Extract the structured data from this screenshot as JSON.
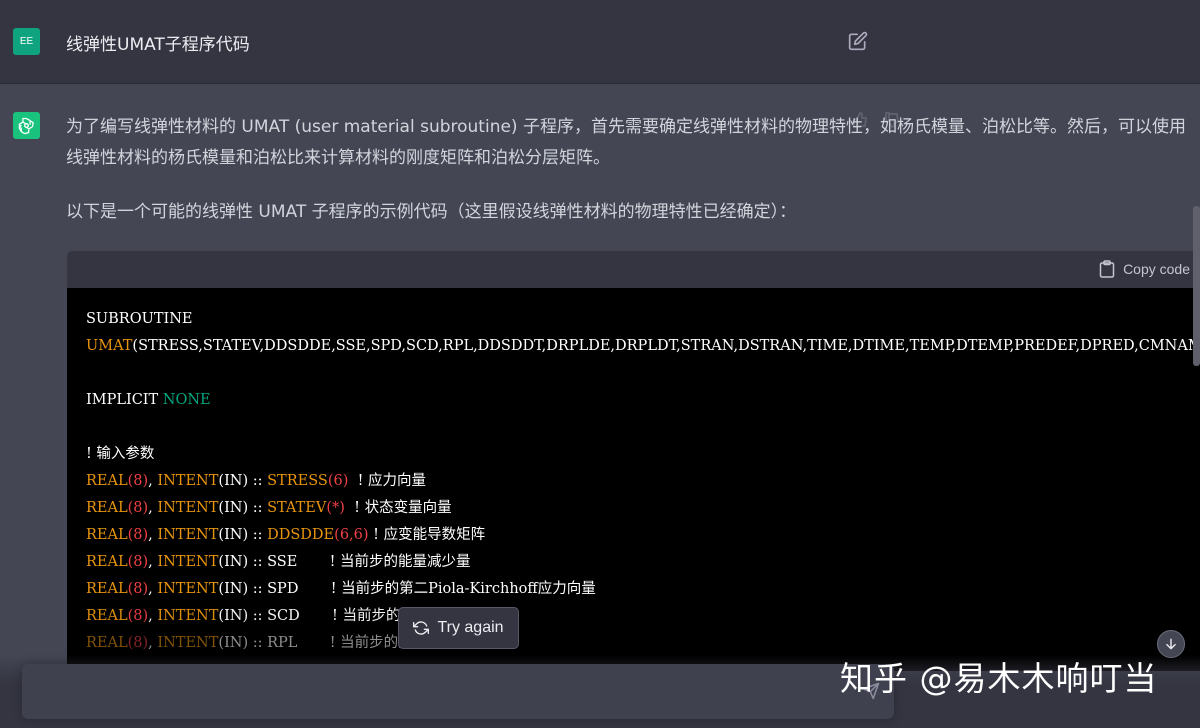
{
  "user": {
    "avatar_initials": "EE",
    "message": "线弹性UMAT子程序代码"
  },
  "assistant": {
    "para1": "为了编写线弹性材料的 UMAT (user material subroutine) 子程序，首先需要确定线弹性材料的物理特性，如杨氏模量、泊松比等。然后，可以使用线弹性材料的杨氏模量和泊松比来计算材料的刚度矩阵和泊松分层矩阵。",
    "para2": "以下是一个可能的线弹性 UMAT 子程序的示例代码（这里假设线弹性材料的物理特性已经确定）："
  },
  "code": {
    "copy_label": "Copy code",
    "l1": "SUBROUTINE",
    "l2_name": "UMAT",
    "l2_args": "(STRESS,STATEV,DDSDDE,SSE,SPD,SCD,RPL,DDSDDT,DRPLDE,DRPLDT,STRAN,DSTRAN,TIME,DTIME,TEMP,DTEMP,PREDEF,DPRED,CMNAME,NNODE,KSTEP,KINC)",
    "l3_kw": "IMPLICIT ",
    "l3_val": "NONE",
    "l4": "! 输入参数",
    "lines": [
      {
        "var": "STRESS",
        "dim": "(6)",
        "pad": "  ",
        "comment": "! 应力向量"
      },
      {
        "var": "STATEV",
        "dim": "(*)",
        "pad": "  ",
        "comment": "! 状态变量向量"
      },
      {
        "var": "DDSDDE",
        "dim": "(6,6)",
        "pad": " ",
        "comment": "! 应变能导数矩阵"
      },
      {
        "var": "SSE",
        "dim": "",
        "pad": "       ",
        "comment": "! 当前步的能量减少量"
      },
      {
        "var": "SPD",
        "dim": "",
        "pad": "       ",
        "comment": "! 当前步的第二Piola-Kirchhoff应力向量"
      },
      {
        "var": "SCD",
        "dim": "",
        "pad": "       ",
        "comment": "! 当前步的剪切应力向量"
      },
      {
        "var": "RPL",
        "dim": "",
        "pad": "       ",
        "comment": "! 当前步的反作用力向量"
      }
    ],
    "real": "REAL",
    "kind": "(8)",
    "intent": "INTENT",
    "in": "(IN) :: "
  },
  "try_again_label": "Try again",
  "watermark": "知乎 @易木木响叮当",
  "colors": {
    "bg_assistant": "#444654",
    "bg_user": "#343541",
    "accent": "#10a37f",
    "code_orange": "#e9950c",
    "code_pink": "#df3079",
    "code_green": "#00a67d"
  }
}
